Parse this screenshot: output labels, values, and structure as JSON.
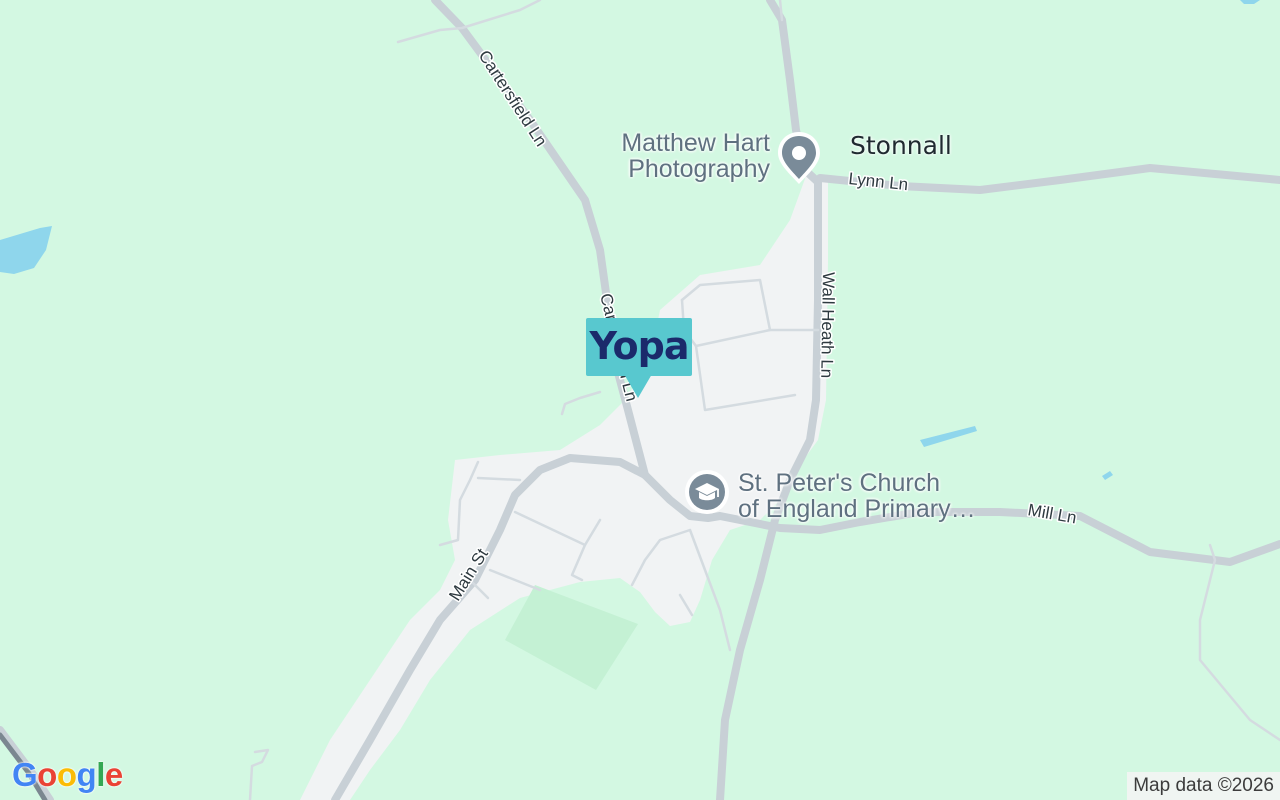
{
  "map": {
    "colors": {
      "land": "#d3f8e2",
      "built_up": "#f1f3f4",
      "road": "#c8d0d6",
      "water": "#8fd6ec",
      "park": "#c4f1d4",
      "label": "#5f7180",
      "pin": "#7a8b99"
    },
    "roads": {
      "cartersfield_north": "Cartersfield Ln",
      "cartersfield_south": "Cartersfield Ln",
      "lynn": "Lynn Ln",
      "wall_heath": "Wall Heath Ln",
      "main": "Main St",
      "mill": "Mill Ln"
    },
    "places": {
      "town": "Stonnall",
      "photographer_line1": "Matthew Hart",
      "photographer_line2": "Photography",
      "school_line1": "St. Peter's Church",
      "school_line2": "of England Primary…"
    },
    "icons": {
      "photographer": "location-pin-icon",
      "school": "school-icon"
    }
  },
  "marker": {
    "brand": "Yopa",
    "color": "#58c8cf",
    "text_color": "#1b2a6b"
  },
  "branding": {
    "logo_text": "Google",
    "attribution": "Map data ©2026"
  }
}
